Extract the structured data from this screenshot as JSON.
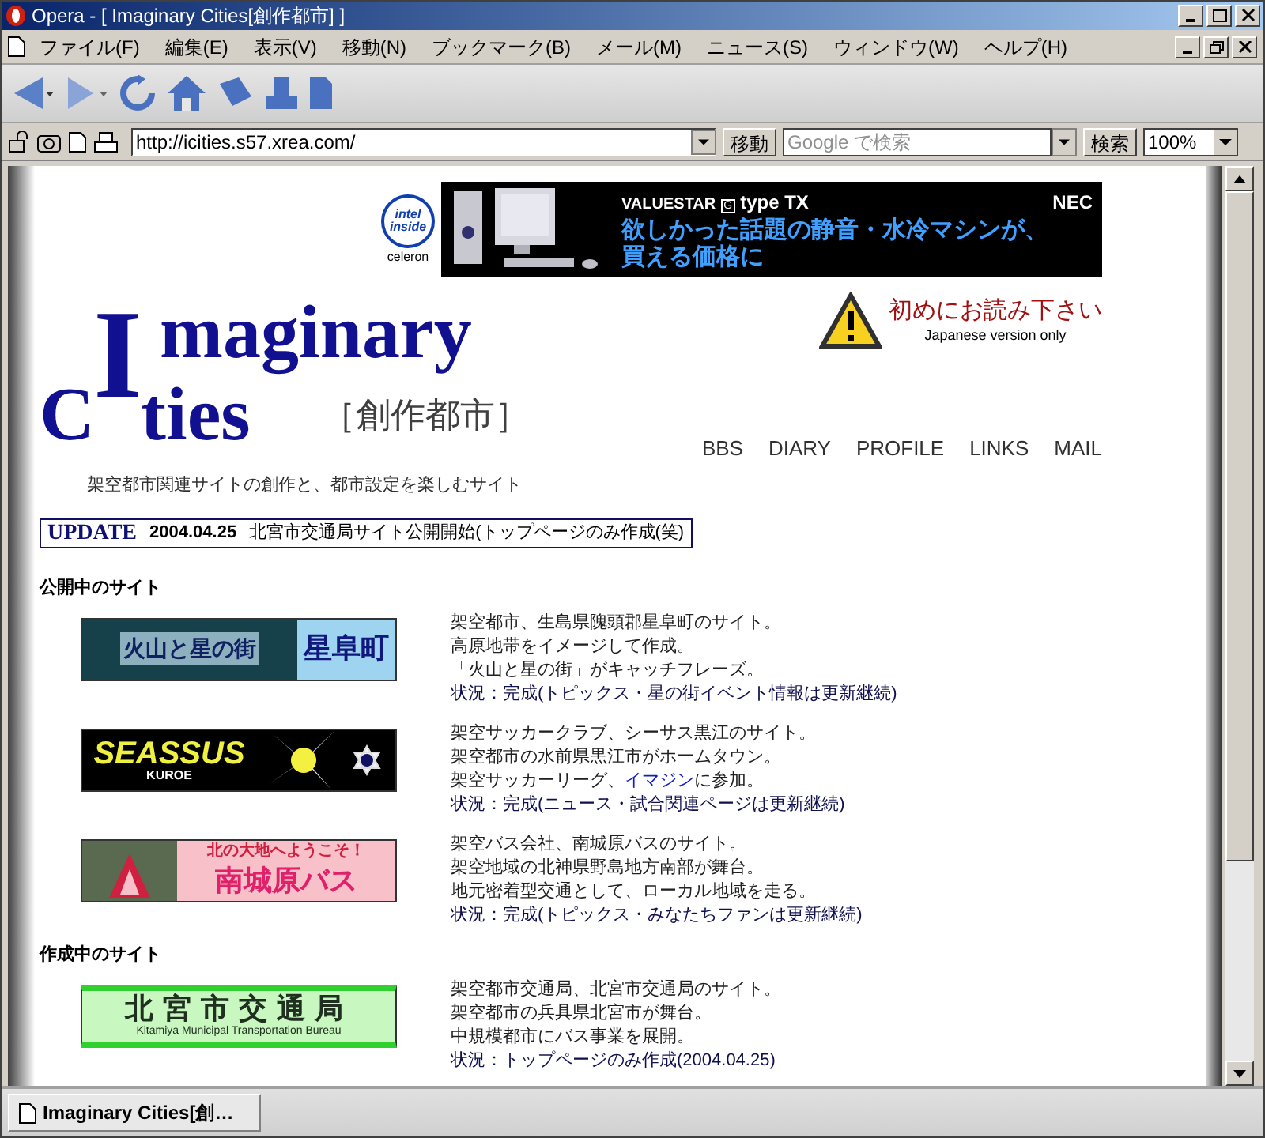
{
  "window": {
    "title": "Opera - [ Imaginary Cities[創作都市] ]"
  },
  "menu": [
    "ファイル(F)",
    "編集(E)",
    "表示(V)",
    "移動(N)",
    "ブックマーク(B)",
    "メール(M)",
    "ニュース(S)",
    "ウィンドウ(W)",
    "ヘルプ(H)"
  ],
  "address_bar": {
    "url": "http://icities.s57.xrea.com/",
    "go": "移動",
    "search_placeholder": "Google で検索",
    "search_button": "検索",
    "zoom": "100%"
  },
  "ad": {
    "intel_top": "intel",
    "intel_bottom": "inside",
    "celeron": "celeron",
    "product": "VALUESTAR",
    "product_mark": "G",
    "product_type": "type TX",
    "brand": "NEC",
    "line_1": "欲しかった話題の静音・水冷マシンが、",
    "line_2": "買える価格に"
  },
  "logo": {
    "line_1": "maginary",
    "line_2": "C",
    "line_2b": "ties",
    "initial": "I",
    "subtitle": "［創作都市］",
    "tagline": "架空都市関連サイトの創作と、都市設定を楽しむサイト"
  },
  "notice": {
    "title": "初めにお読み下さい",
    "note": "Japanese version only"
  },
  "nav": [
    "BBS",
    "DIARY",
    "PROFILE",
    "LINKS",
    "MAIL"
  ],
  "update": {
    "label": "UPDATE",
    "date": "2004.04.25",
    "text": "北宮市交通局サイト公開開始(トップページのみ作成(笑)"
  },
  "sections": [
    {
      "heading": "公開中のサイト",
      "sites": [
        {
          "kind": "town",
          "banner": [
            "火山と星の街",
            "星阜町"
          ],
          "lines": [
            {
              "text": "架空都市、生島県隗頭郡星阜町のサイト。"
            },
            {
              "text": "高原地帯をイメージして作成。"
            },
            {
              "text": "「火山と星の街」がキャッチフレーズ。"
            }
          ],
          "status": "状況：完成(トピックス・星の街イベント情報は更新継続)"
        },
        {
          "kind": "soccer",
          "banner": [
            "SEASSUS",
            "KUROE"
          ],
          "lines": [
            {
              "text": "架空サッカークラブ、シーサス黒江のサイト。"
            },
            {
              "text": "架空都市の水前県黒江市がホームタウン。"
            },
            {
              "before": "架空サッカーリーグ、",
              "link": "イマジン",
              "after": "に参加。"
            }
          ],
          "status": "状況：完成(ニュース・試合関連ページは更新継続)"
        },
        {
          "kind": "bus",
          "banner": [
            "北の大地へようこそ！",
            "南城原バス"
          ],
          "lines": [
            {
              "text": "架空バス会社、南城原バスのサイト。"
            },
            {
              "text": "架空地域の北神県野島地方南部が舞台。"
            },
            {
              "text": "地元密着型交通として、ローカル地域を走る。"
            }
          ],
          "status": "状況：完成(トピックス・みなたちファンは更新継続)"
        }
      ]
    },
    {
      "heading": "作成中のサイト",
      "sites": [
        {
          "kind": "transit",
          "banner": [
            "北宮市交通局",
            "Kitamiya Municipal Transportation Bureau"
          ],
          "lines": [
            {
              "text": "架空都市交通局、北宮市交通局のサイト。"
            },
            {
              "text": "架空都市の兵具県北宮市が舞台。"
            },
            {
              "text": "中規模都市にバス事業を展開。"
            }
          ],
          "status": "状況：トップページのみ作成(2004.04.25)"
        }
      ]
    }
  ],
  "tab": {
    "label": "Imaginary Cities[創…"
  }
}
